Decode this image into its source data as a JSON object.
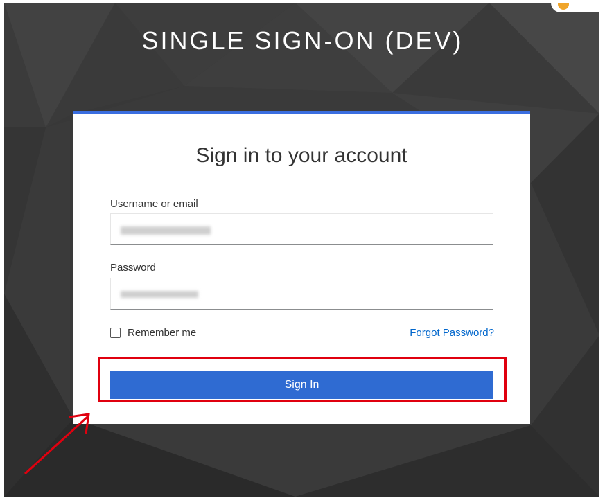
{
  "page": {
    "title": "SINGLE SIGN-ON (DEV)"
  },
  "login_card": {
    "heading": "Sign in to your account",
    "username_label": "Username or email",
    "password_label": "Password",
    "remember_label": "Remember me",
    "forgot_label": "Forgot Password?",
    "signin_label": "Sign In"
  },
  "annotation": {
    "highlight_color": "#e0000f"
  },
  "colors": {
    "accent": "#2f6bd2",
    "link": "#0066cc",
    "background": "#3a3a3a"
  }
}
